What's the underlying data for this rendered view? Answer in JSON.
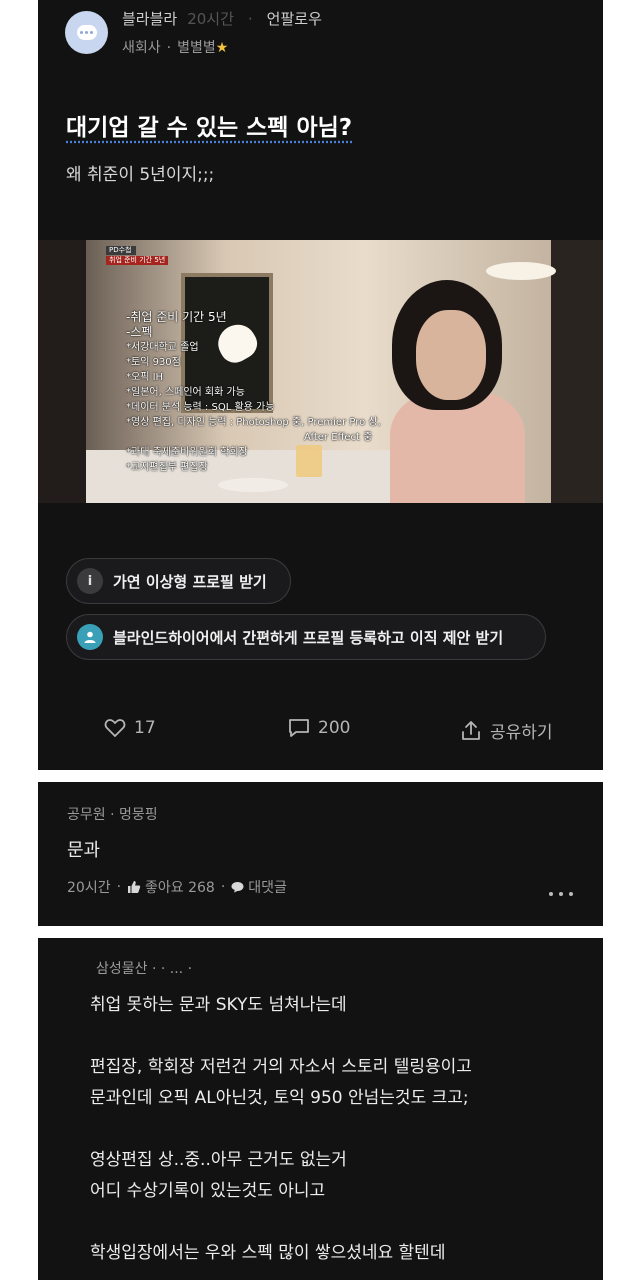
{
  "post": {
    "author": "블라블라",
    "time": "20시간",
    "follow_label": "언팔로우",
    "company": "새회사",
    "nickname": "별별별",
    "title": "대기업 갈 수 있는 스펙 아님?",
    "body": "왜 취준이 5년이지;;;",
    "video_overlay": {
      "caption_tag": "PD수첩",
      "caption": "취업 준비 기간 5년",
      "lines": [
        "-취업 준비 기간 5년",
        "-스펙",
        "*서강대학교 졸업",
        "*토익 930점",
        "*오픽 IH",
        "*일본어, 스페인어 회화 가능",
        "*데이터 분석 능력 : SQL 활용 가능",
        "*영상 편집, 디자인 능력 : Photoshop 중, Premier Pro 상,",
        "After Effect 중",
        "*과대 축제준비위원회 학회장",
        "*교지편집부 편집장"
      ]
    },
    "pill_profile": "가연 이상형 프로필 받기",
    "pill_blind": "블라인드하이어에서 간편하게 프로필 등록하고 이직 제안 받기",
    "likes": "17",
    "comments": "200",
    "share_label": "공유하기"
  },
  "comment1": {
    "author": "공무원 · 멍뭉핑",
    "text": "문과",
    "time": "20시간",
    "like_label": "좋아요 268",
    "reply_label": "대댓글"
  },
  "comment2": {
    "author": "삼성물산 · · ... ·",
    "lines": [
      "취업 못하는 문과 SKY도 넘쳐나는데",
      "",
      "편집장, 학회장 저런건 거의 자소서 스토리 텔링용이고",
      "문과인데 오픽 AL아닌것, 토익 950 안넘는것도 크고;",
      "",
      "영상편집 상..중..아무 근거도 없는거",
      "어디 수상기록이 있는것도 아니고",
      "",
      "학생입장에서는 우와 스펙 많이 쌓으셨네요 할텐데"
    ]
  },
  "colors": {
    "card_bg": "#121213",
    "avatar_bg": "#c9d6ef",
    "star": "#f3c33b",
    "blind_icon": "#3aa0b8"
  }
}
